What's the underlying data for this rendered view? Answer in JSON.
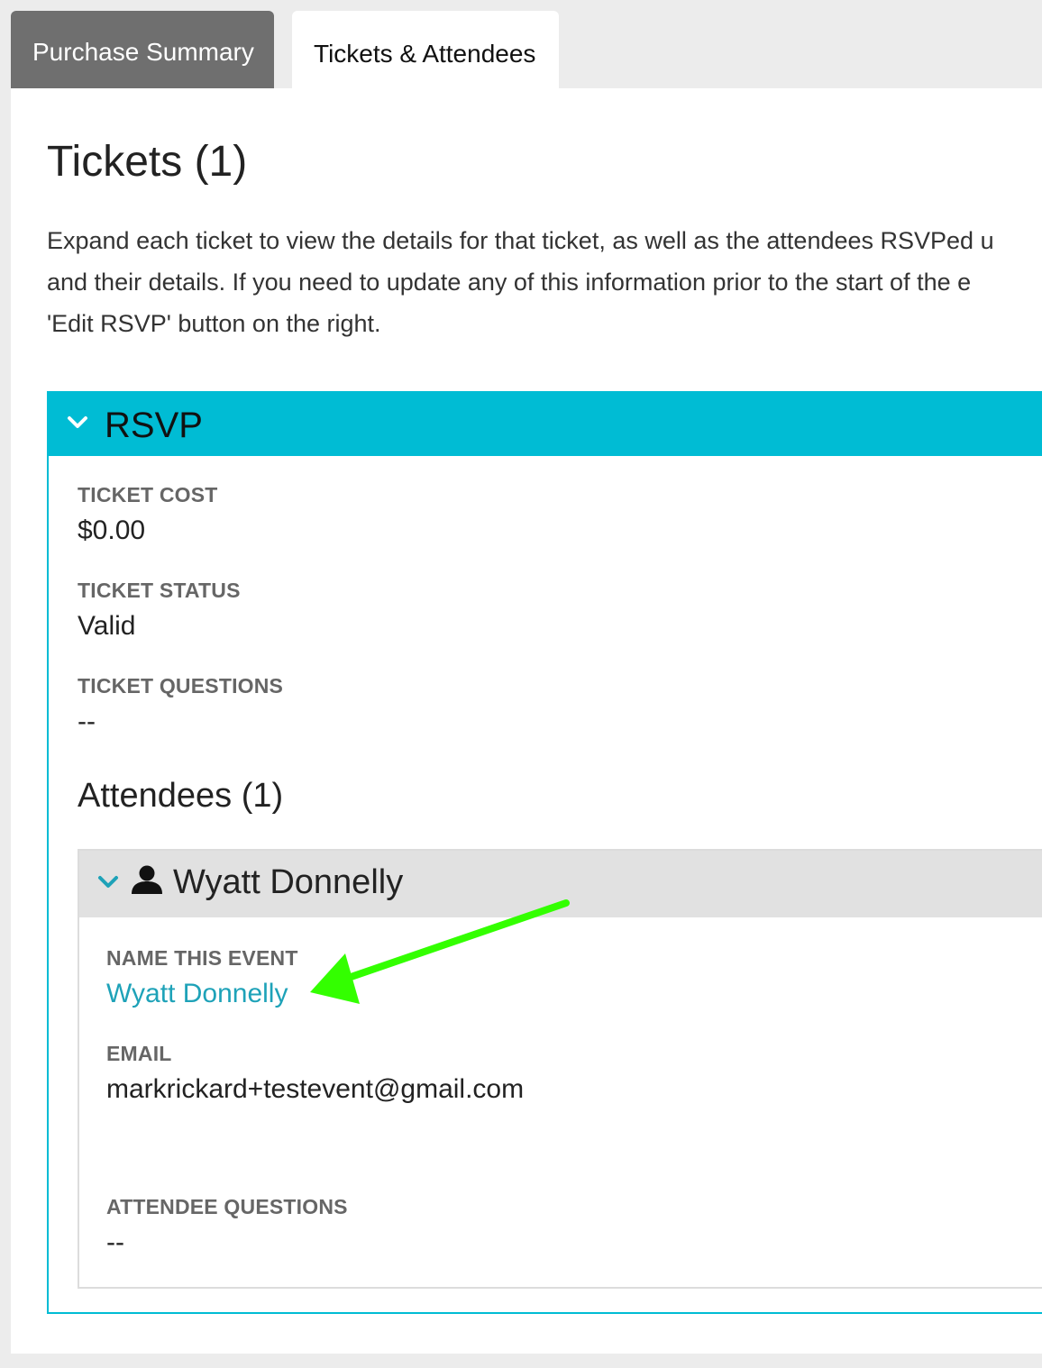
{
  "tabs": [
    {
      "label": "Purchase Summary",
      "active": false
    },
    {
      "label": "Tickets & Attendees",
      "active": true
    }
  ],
  "main": {
    "title": "Tickets (1)",
    "intro_lines": [
      "Expand each ticket to view the details for that ticket, as well as the attendees RSVPed u",
      "and their details. If you need to update any of this information prior to the start of the e",
      "'Edit RSVP' button on the right."
    ]
  },
  "ticket": {
    "name": "RSVP",
    "fields": [
      {
        "label": "TICKET COST",
        "value": "$0.00"
      },
      {
        "label": "TICKET STATUS",
        "value": "Valid"
      },
      {
        "label": "TICKET QUESTIONS",
        "value": "--"
      }
    ],
    "attendees_title": "Attendees (1)",
    "attendee": {
      "name": "Wyatt Donnelly",
      "fields": [
        {
          "label": "NAME THIS EVENT",
          "value": "Wyatt Donnelly"
        },
        {
          "label": "EMAIL",
          "value": "markrickard+testevent@gmail.com"
        },
        {
          "label": "ATTENDEE QUESTIONS",
          "value": "--"
        }
      ]
    }
  },
  "colors": {
    "accent": "#00bcd4",
    "link": "#1ea2b8",
    "annotation_arrow": "#33ff00",
    "inactive_tab": "#6f6f6f"
  },
  "icons": {
    "ticket_toggle": "chevron-down-icon",
    "attendee_toggle": "chevron-down-icon",
    "attendee": "person-icon",
    "annotation": "arrow-icon"
  }
}
